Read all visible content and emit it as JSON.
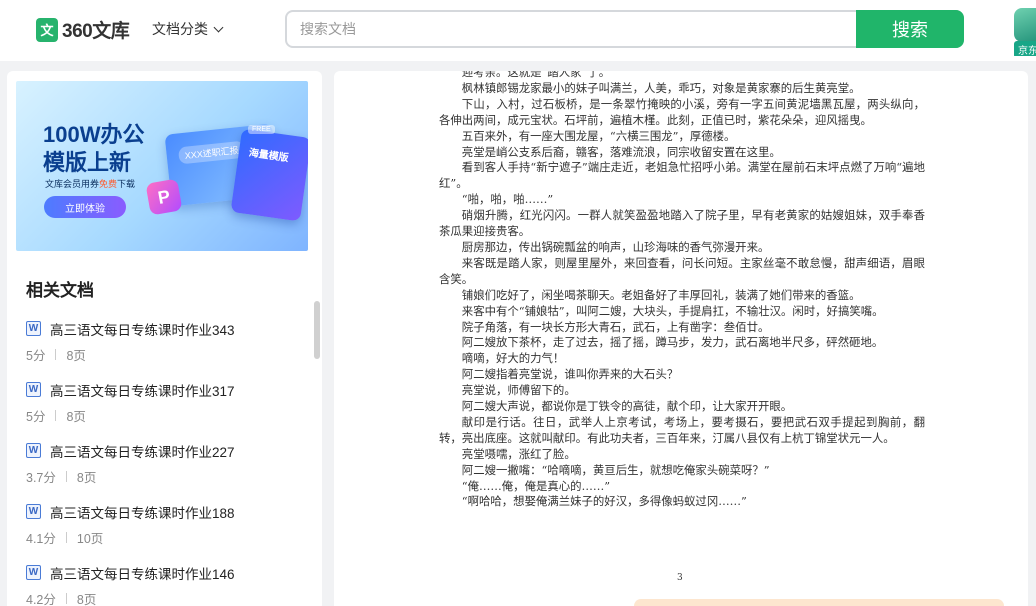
{
  "header": {
    "logo_mark": "文",
    "logo_text": "360文库",
    "category_label": "文档分类",
    "search_placeholder": "搜索文档",
    "search_button": "搜索",
    "jd_label": "京东"
  },
  "banner": {
    "title": "100W办公\n模版上新",
    "subtitle_prefix": "文库会员用券",
    "subtitle_highlight": "免费",
    "subtitle_suffix": "下载",
    "button": "立即体验",
    "card1_label": "XXX述职汇报",
    "card2_label": "海量模版",
    "free_tag": "FREE",
    "p_icon": "P"
  },
  "related": {
    "title": "相关文档",
    "items": [
      {
        "icon": "W",
        "title": "高三语文每日专练课时作业343",
        "size": "5分",
        "pages": "8页"
      },
      {
        "icon": "W",
        "title": "高三语文每日专练课时作业317",
        "size": "5分",
        "pages": "8页"
      },
      {
        "icon": "W",
        "title": "高三语文每日专练课时作业227",
        "size": "3.7分",
        "pages": "8页"
      },
      {
        "icon": "W",
        "title": "高三语文每日专练课时作业188",
        "size": "4.1分",
        "pages": "10页"
      },
      {
        "icon": "W",
        "title": "高三语文每日专练课时作业146",
        "size": "4.2分",
        "pages": "8页"
      }
    ]
  },
  "document": {
    "paragraphs": [
      "迎考亲。这就是“踏人家”了。",
      "枫林镇郎锡龙家最小的妹子叫满兰，人美，乖巧，对象是黄家寨的后生黄亮堂。",
      "下山，入村，过石板桥，是一条翠竹掩映的小溪，旁有一字五间黄泥墙黑瓦屋，两头纵向，各伸出两间，成元宝状。石坪前，遍植木槿。此刻，正值已时，紫花朵朵，迎风摇曳。",
      "五百来外，有一座大围龙屋，“六横三围龙”，厚德楼。",
      "亮堂是峭公支系后裔，赣客，落难流浪，同宗收留安置在这里。",
      "看到客人手持“新宁遮子”端庄走近，老姐急忙招呼小弟。满堂在屋前石末坪点燃了万响“遍地红”。",
      "“啪，啪，啪……”",
      "硝烟升腾，红光闪闪。一群人就笑盈盈地踏入了院子里，早有老黄家的姑嫂姐妹，双手奉香茶瓜果迎接贵客。",
      "厨房那边，传出锅碗瓢盆的响声，山珍海味的香气弥漫开来。",
      "来客既是踏人家，则屋里屋外，来回查看，问长问短。主家丝毫不敢怠慢，甜声细语，眉眼含笑。",
      "铺娘们吃好了，闲坐喝茶聊天。老姐备好了丰厚回礼，装满了她们带来的香篮。",
      "来客中有个“铺娘牯”，叫阿二嫂，大块头，手提肩扛，不输壮汉。闲时，好搞笑嘴。",
      "院子角落，有一块长方形大青石，武石，上有凿字：叁佰廿。",
      "阿二嫂放下茶杯，走了过去，摇了摇，蹲马步，发力，武石离地半尺多，砰然砸地。",
      "嘀嘀，好大的力气！",
      "阿二嫂指着亮堂说，谁叫你弄来的大石头？",
      "亮堂说，师傅留下的。",
      "阿二嫂大声说，都说你是丁铁令的高徒，献个印，让大家开开眼。",
      "献印是行话。往日，武举人上京考试，考场上，要考摄石，要把武石双手提起到胸前，翻转，亮出底座。这就叫献印。有此功夫者，三百年来，汀属八县仅有上杭丁锦堂状元一人。",
      "亮堂嗫嚅，涨红了脸。",
      "阿二嫂一撇嘴：“哈嘀嘀，黄亘后生，就想吃俺家头碗菜呀？”",
      "“俺……俺，俺是真心的……”",
      "“啊哈哈，想娶俺满兰妹子的好汉，多得像蚂蚁过冈……”"
    ],
    "page_number": "3"
  }
}
